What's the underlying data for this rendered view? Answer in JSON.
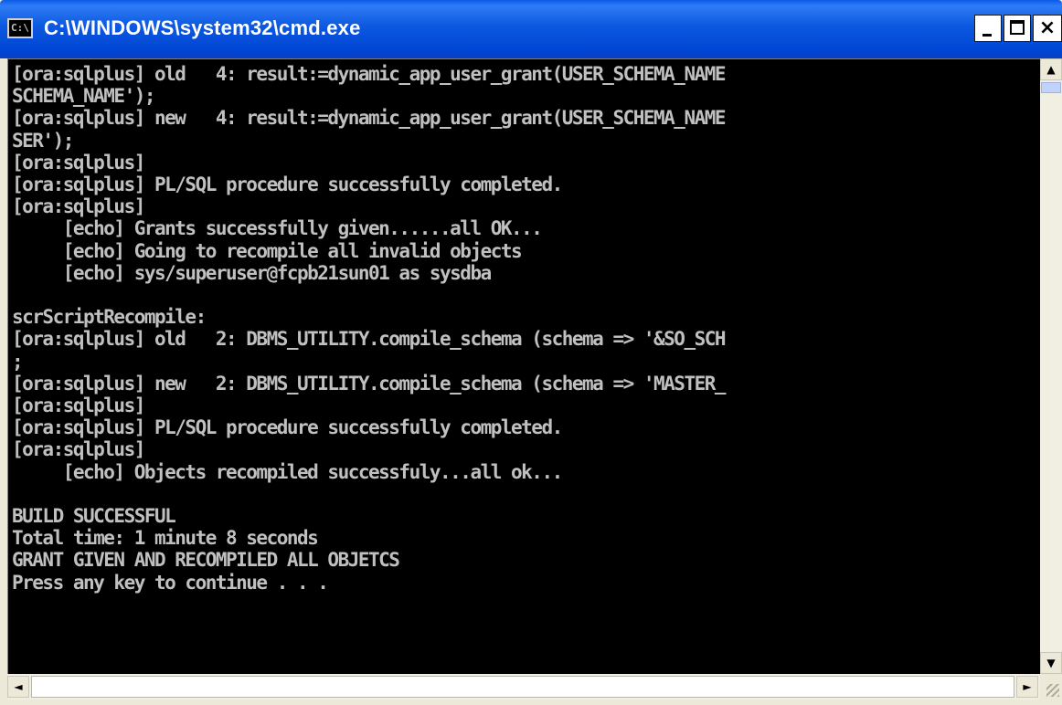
{
  "window": {
    "title": "C:\\WINDOWS\\system32\\cmd.exe",
    "icon_text": "C:\\",
    "icon": "console-app-icon",
    "controls": {
      "minimize_icon": "minimize-icon",
      "maximize_icon": "maximize-icon",
      "close_label": "×"
    }
  },
  "console": {
    "text_color": "#c0c0c0",
    "background": "#000000",
    "lines": [
      "[ora:sqlplus] old   4: result:=dynamic_app_user_grant(USER_SCHEMA_NAME",
      "SCHEMA_NAME');",
      "[ora:sqlplus] new   4: result:=dynamic_app_user_grant(USER_SCHEMA_NAME",
      "SER');",
      "[ora:sqlplus]",
      "[ora:sqlplus] PL/SQL procedure successfully completed.",
      "[ora:sqlplus]",
      "     [echo] Grants successfully given......all OK...",
      "     [echo] Going to recompile all invalid objects",
      "     [echo] sys/superuser@fcpb21sun01 as sysdba",
      "",
      "scrScriptRecompile:",
      "[ora:sqlplus] old   2: DBMS_UTILITY.compile_schema (schema => '&SO_SCH",
      ";",
      "[ora:sqlplus] new   2: DBMS_UTILITY.compile_schema (schema => 'MASTER_",
      "[ora:sqlplus]",
      "[ora:sqlplus] PL/SQL procedure successfully completed.",
      "[ora:sqlplus]",
      "     [echo] Objects recompiled successfuly...all ok...",
      "",
      "BUILD SUCCESSFUL",
      "Total time: 1 minute 8 seconds",
      "GRANT GIVEN AND RECOMPILED ALL OBJETCS",
      "Press any key to continue . . ."
    ]
  },
  "scrollbars": {
    "up_arrow": "▲",
    "down_arrow": "▼",
    "left_arrow": "◄",
    "right_arrow": "►"
  }
}
